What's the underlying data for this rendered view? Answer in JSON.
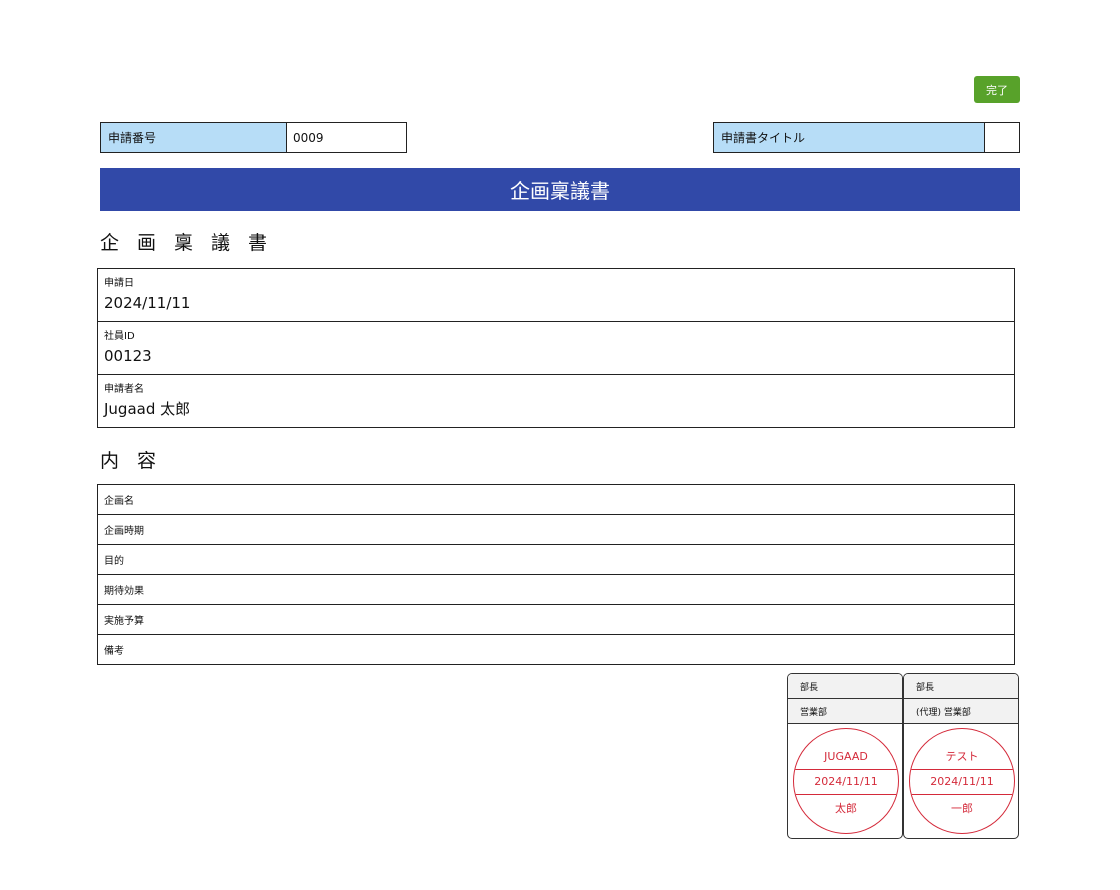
{
  "toolbar": {
    "complete_label": "完了"
  },
  "header": {
    "number_label": "申請番号",
    "number_value": "0009",
    "title_label": "申請書タイトル",
    "title_value": ""
  },
  "banner": {
    "title": "企画稟議書"
  },
  "sections": {
    "document_heading": "企画稟議書",
    "content_heading": "内容"
  },
  "applicant": {
    "rows": [
      {
        "label": "申請日",
        "value": "2024/11/11"
      },
      {
        "label": "社員ID",
        "value": "00123"
      },
      {
        "label": "申請者名",
        "value": "Jugaad 太郎"
      }
    ]
  },
  "content": {
    "rows": [
      {
        "label": "企画名"
      },
      {
        "label": "企画時期"
      },
      {
        "label": "目的"
      },
      {
        "label": "期待効果"
      },
      {
        "label": "実施予算"
      },
      {
        "label": "備考"
      }
    ]
  },
  "approvals": [
    {
      "role": "部長",
      "department": "営業部",
      "stamp": {
        "name": "JUGAAD",
        "date": "2024/11/11",
        "given_name": "太郎"
      }
    },
    {
      "role": "部長",
      "department": "(代理) 営業部",
      "stamp": {
        "name": "テスト",
        "date": "2024/11/11",
        "given_name": "一郎"
      }
    }
  ],
  "colors": {
    "banner": "#3149a8",
    "label_bg": "#b7ddf7",
    "complete_button": "#58a22a",
    "stamp": "#d42a3a"
  }
}
